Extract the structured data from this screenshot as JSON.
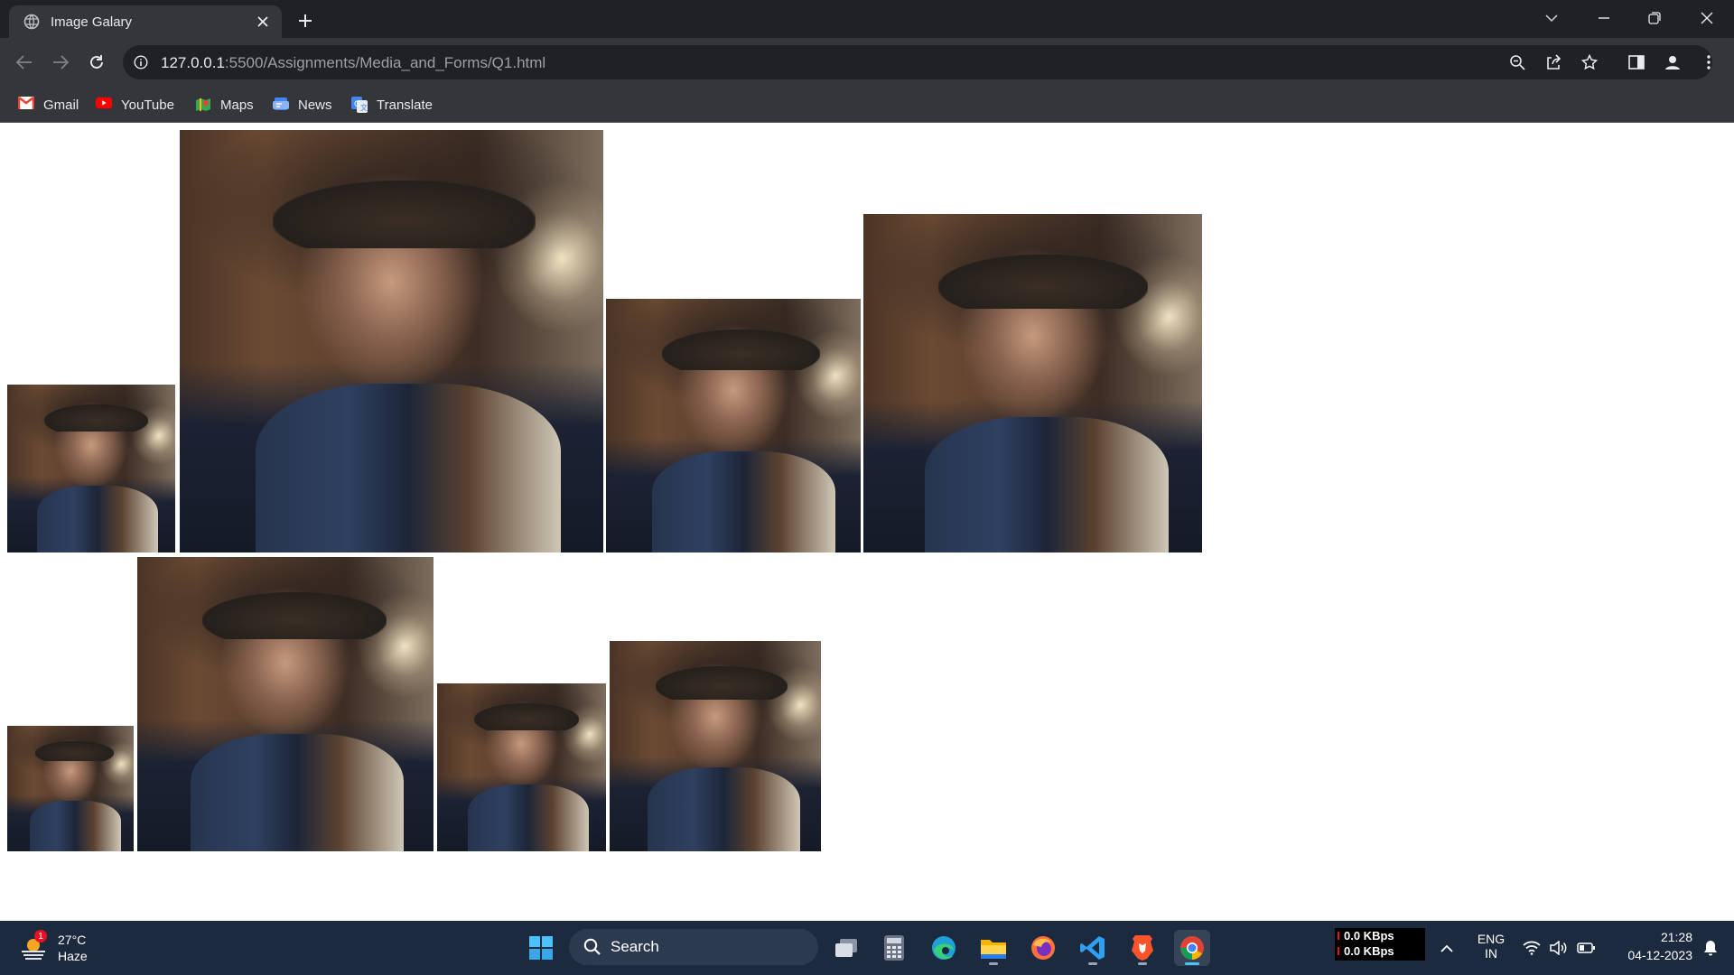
{
  "browser": {
    "tab_title": "Image Galary",
    "url_host": "127.0.0.1",
    "url_path": ":5500/Assignments/Media_and_Forms/Q1.html"
  },
  "bookmarks": [
    {
      "label": "Gmail",
      "icon": "gmail-icon"
    },
    {
      "label": "YouTube",
      "icon": "youtube-icon"
    },
    {
      "label": "Maps",
      "icon": "maps-icon"
    },
    {
      "label": "News",
      "icon": "news-icon"
    },
    {
      "label": "Translate",
      "icon": "translate-icon"
    }
  ],
  "gallery": {
    "image_count": 8,
    "subject": "portrait of a man in a wide-brimmed hat and vest",
    "rows": 2
  },
  "taskbar": {
    "weather": {
      "temp": "27°C",
      "desc": "Haze",
      "badge": "1"
    },
    "search_label": "Search",
    "apps": [
      "windows-start-icon",
      "task-view-icon",
      "calculator-icon",
      "edge-icon",
      "file-explorer-icon",
      "firefox-icon",
      "vscode-icon",
      "brave-icon",
      "chrome-icon"
    ],
    "network": {
      "up": "0.0 KBps",
      "down": "0.0 KBps"
    },
    "language": {
      "line1": "ENG",
      "line2": "IN"
    },
    "time": "21:28",
    "date": "04-12-2023"
  }
}
